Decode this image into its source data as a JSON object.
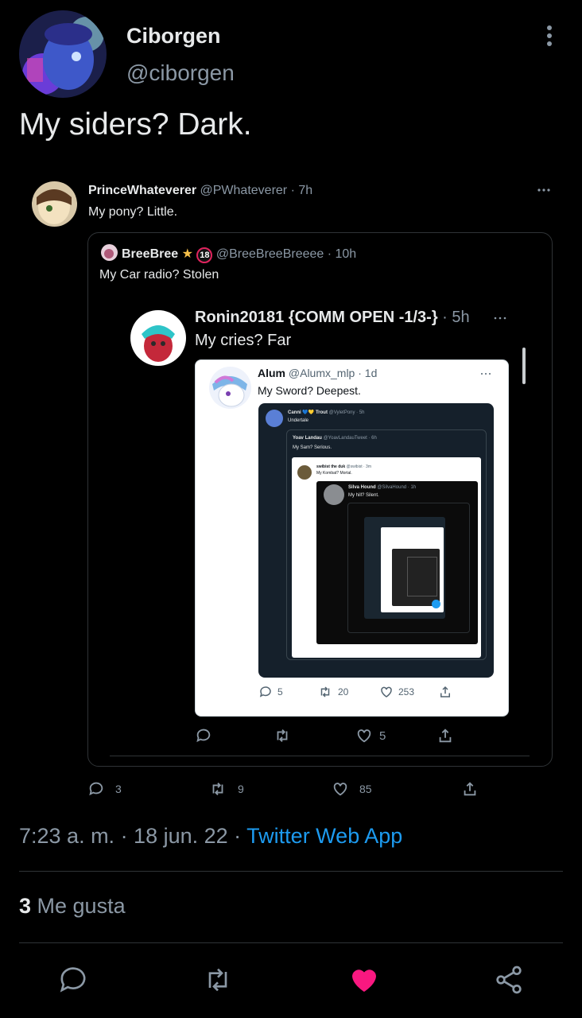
{
  "tweet": {
    "display_name": "Ciborgen",
    "handle": "@ciborgen",
    "text": "My siders? Dark.",
    "time": "7:23 a. m. · 18 jun. 22 · ",
    "source": "Twitter Web App",
    "likes_count": "3",
    "likes_label": " Me gusta"
  },
  "quote1": {
    "name": "PrinceWhateverer",
    "handle_time": " @PWhateverer · 7h",
    "text": "My pony? Little.",
    "replies": "3",
    "retweets": "9",
    "likes": "85"
  },
  "quote2": {
    "name": "BreeBree",
    "badge": "18",
    "handle_time": " @BreeBreeBreeee · 10h",
    "text": "My Car radio? Stolen"
  },
  "quote3": {
    "name": "Ronin20181 {COMM OPEN -1/3-}",
    "handle_time": " · 5h",
    "text": "My cries? Far",
    "replies": "",
    "retweets": "",
    "likes": "5"
  },
  "quote4": {
    "name": "Alum",
    "handle_time": " @Alumx_mlp · 1d",
    "text": "My Sword? Deepest.",
    "replies": "5",
    "retweets": "20",
    "likes": "253"
  },
  "quote5": {
    "name": "Canni 💙💛 Trout",
    "handle_time": " @VyletPony · 5h",
    "text": "Undertale"
  },
  "quote6": {
    "name": "Yoav Landau",
    "handle_time": " @YoavLandauTweet · 6h",
    "text": "My Sam? Serious."
  },
  "quote7": {
    "name": "swibist the duk",
    "handle_time": " @swibist · 3m",
    "text": "My Kombat? Mortal."
  },
  "quote8": {
    "name": "Silva Hound",
    "handle_time": " @SilvaHound · 1h",
    "text": "My hill? Silent."
  }
}
